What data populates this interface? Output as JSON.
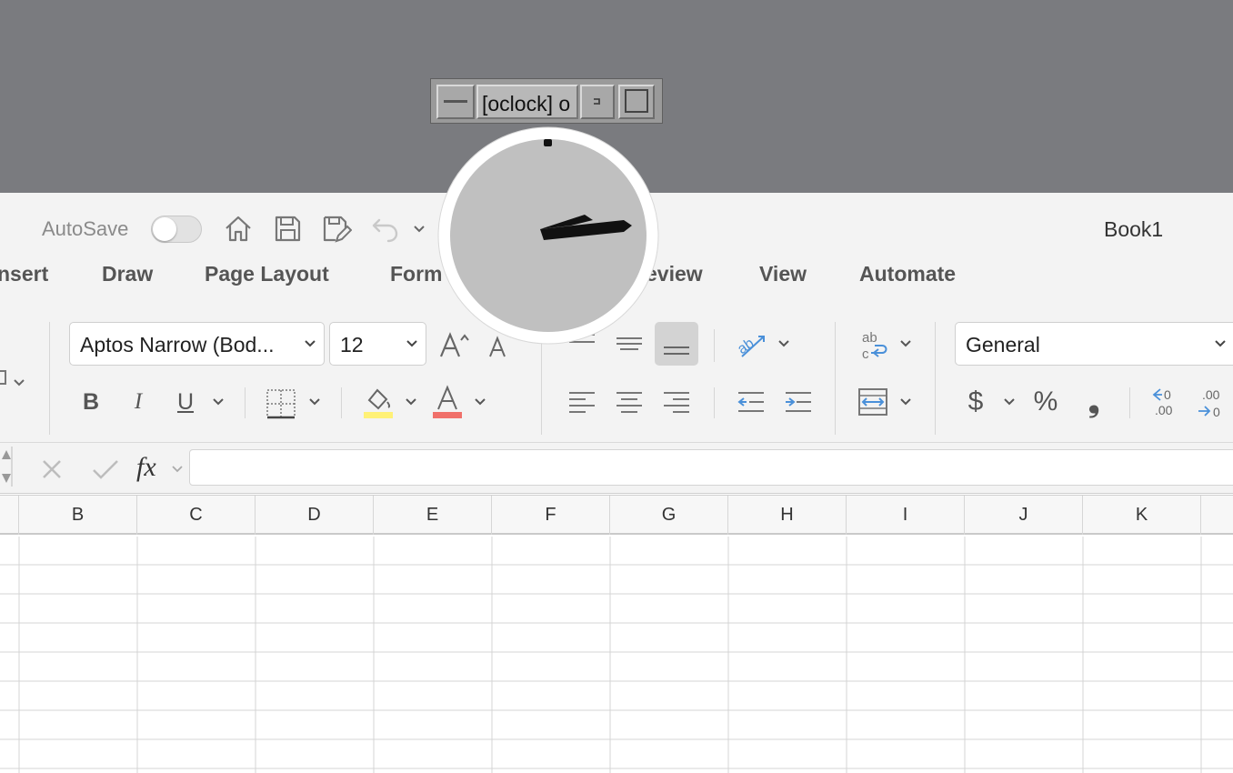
{
  "excel": {
    "title": "Book1",
    "autosave_label": "AutoSave",
    "autosave_on": false,
    "tabs": [
      "nsert",
      "Draw",
      "Page Layout",
      "Form",
      "eview",
      "View",
      "Automate"
    ],
    "ribbon": {
      "font_name": "Aptos Narrow (Bod...",
      "font_size": "12",
      "number_format": "General",
      "bold": "B",
      "italic": "I",
      "underline": "U",
      "font_color_letter": "A",
      "highlight_color": "#fff176",
      "font_color": "#f0706a",
      "currency": "$",
      "percent": "%",
      "comma": "❟",
      "fx": "fx"
    },
    "columns": [
      "B",
      "C",
      "D",
      "E",
      "F",
      "G",
      "H",
      "I",
      "J",
      "K"
    ]
  },
  "oclock": {
    "title": "[oclock] o"
  }
}
